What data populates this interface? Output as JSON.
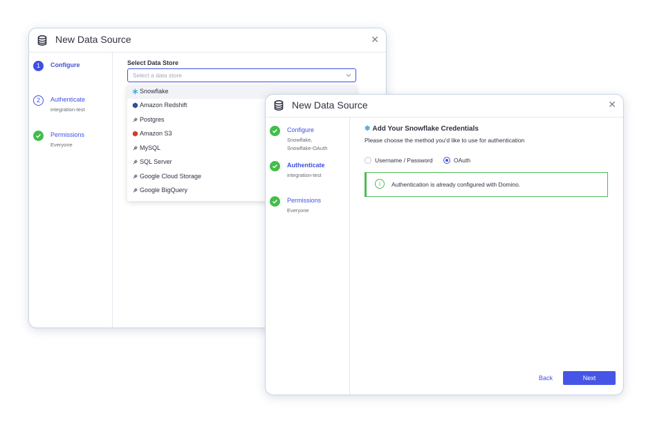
{
  "back_dialog": {
    "title": "New Data Source",
    "close_glyph": "✕",
    "steps": [
      {
        "number": "1",
        "name": "Configure",
        "sub": "",
        "state": "active"
      },
      {
        "number": "2",
        "name": "Authenticate",
        "sub": "integration-test",
        "state": "pending"
      },
      {
        "number": "",
        "name": "Permissions",
        "sub": "Everyone",
        "state": "done"
      }
    ],
    "select_label": "Select Data Store",
    "select_placeholder": "Select a data store",
    "options": [
      {
        "label": "Snowflake",
        "icon": "snowflake-icon"
      },
      {
        "label": "Amazon Redshift",
        "icon": "redshift-icon"
      },
      {
        "label": "Postgres",
        "icon": "plug-icon"
      },
      {
        "label": "Amazon S3",
        "icon": "s3-icon"
      },
      {
        "label": "MySQL",
        "icon": "plug-icon"
      },
      {
        "label": "SQL Server",
        "icon": "plug-icon"
      },
      {
        "label": "Google Cloud Storage",
        "icon": "plug-icon"
      },
      {
        "label": "Google BigQuery",
        "icon": "plug-icon"
      }
    ]
  },
  "front_dialog": {
    "title": "New Data Source",
    "close_glyph": "✕",
    "steps": [
      {
        "name": "Configure",
        "sub1": "Snowflake,",
        "sub2": "Snowflake-OAuth",
        "state": "done"
      },
      {
        "name": "Authenticate",
        "sub1": "integration-test",
        "state": "done"
      },
      {
        "name": "Permissions",
        "sub1": "Everyone",
        "state": "done"
      }
    ],
    "heading_icon": "❄",
    "heading": "Add Your Snowflake Credentials",
    "subheading": "Please choose the method you'd like to use for authentication",
    "auth_methods": [
      {
        "label": "Username / Password",
        "selected": false
      },
      {
        "label": "OAuth",
        "selected": true
      }
    ],
    "alert_icon": "i",
    "alert_text": "Authentication is already configured with Domino.",
    "back_label": "Back",
    "next_label": "Next"
  },
  "colors": {
    "accent": "#3f4fe0",
    "success": "#43bd4a",
    "snowflake": "#29a8e0",
    "redshift": "#2f4f9e",
    "s3": "#d63d2f"
  }
}
